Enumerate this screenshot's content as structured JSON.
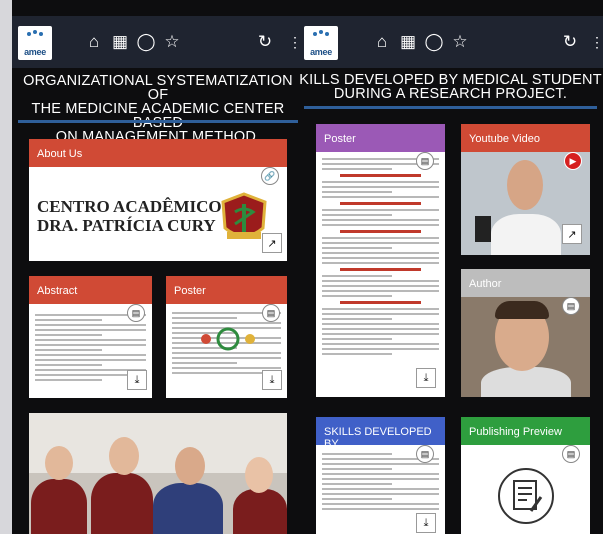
{
  "app": {
    "logo_text": "amee",
    "colors": {
      "topbar": "#1f2430",
      "about": "#d04a35",
      "abstract": "#d04a35",
      "poster_left": "#d04a35",
      "poster_right": "#9b59b6",
      "youtube": "#d04a35",
      "author": "#bdbdbd",
      "skills": "#4060c8",
      "publishing": "#2e9e3e"
    },
    "nav_icons": [
      "home-icon",
      "qr-code-icon",
      "chat-icon",
      "star-icon"
    ],
    "refresh_icon": "refresh-icon",
    "more_icon": "more-vertical-icon"
  },
  "left": {
    "title_line1": "ORGANIZATIONAL SYSTEMATIZATION OF",
    "title_line2": "THE MEDICINE ACADEMIC CENTER BASED",
    "title_line3": "ON MANAGEMENT METHOD.",
    "about": {
      "title": "About Us",
      "banner_line1": "CENTRO ACADÊMICO",
      "banner_line2": "DRA. PATRÍCIA CURY"
    },
    "abstract": {
      "title": "Abstract"
    },
    "poster": {
      "title": "Poster"
    }
  },
  "right": {
    "title_line1": "KILLS DEVELOPED BY MEDICAL STUDENT",
    "title_line2": "DURING A RESEARCH PROJECT.",
    "poster": {
      "title": "Poster"
    },
    "youtube": {
      "title": "Youtube Video"
    },
    "author": {
      "title": "Author"
    },
    "skills": {
      "title": "SKILLS DEVELOPED BY"
    },
    "publishing": {
      "title": "Publishing Preview"
    }
  }
}
